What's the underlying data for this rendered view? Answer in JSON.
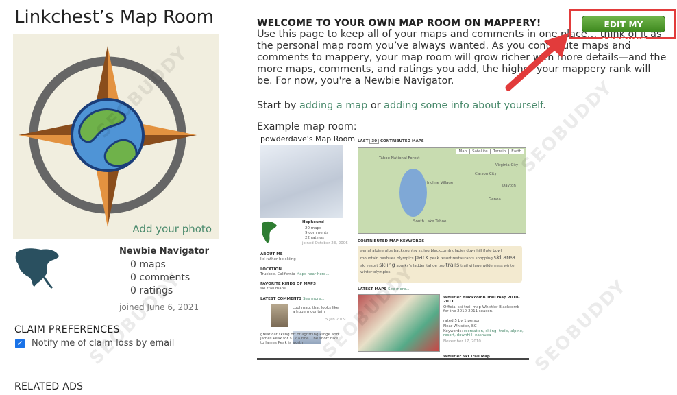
{
  "left": {
    "title": "Linkchest’s Map Room",
    "add_photo": "Add your photo",
    "rank": "Newbie Navigator",
    "stats": [
      {
        "count": "0",
        "label": "maps"
      },
      {
        "count": "0",
        "label": "comments"
      },
      {
        "count": "0",
        "label": "ratings"
      }
    ],
    "joined": "joined June 6, 2021",
    "claim_heading": "CLAIM PREFERENCES",
    "claim_option": "Notify me of claim loss by email",
    "claim_checked": true,
    "related_heading": "RELATED ADS"
  },
  "main": {
    "welcome_heading": "WELCOME TO YOUR OWN MAP ROOM ON MAPPERY!",
    "intro": "Use this page to keep all of your maps and comments in one place… think of it as the personal map room you’ve always wanted. As you contribute maps and comments to mappery, your map room will grow richer with more details—and the more maps, comments, and ratings you add, the higher your mappery rank will be. For now, you're a Newbie Navigator.",
    "start_prefix": "Start by",
    "link_add_map": "adding a map",
    "start_or": "or",
    "link_add_info": "adding some info about yourself",
    "start_suffix": ".",
    "example_label": "Example map room:",
    "edit_account": "EDIT MY ACCOUNT"
  },
  "example": {
    "title": "powderdave's Map Room",
    "username": "Hophound",
    "stats": [
      "20 maps",
      "9 comments",
      "22 ratings"
    ],
    "joined": "joined October 23, 2006",
    "about_heading": "ABOUT ME",
    "about_text": "I'd rather be skiing",
    "location_heading": "LOCATION",
    "location_text": "Truckee, California",
    "location_link": "Maps near here...",
    "favorite_heading": "FAVORITE KINDS OF MAPS",
    "favorite_text": "ski trail maps",
    "latest_comments_heading": "LATEST COMMENTS",
    "see_more": "See more...",
    "comment1": "cool map, that looks like a huge mountain",
    "comment1_date": "5 Jan 2009",
    "comment2": "great cat skiing off of lightning Ridge and James Peak for $12 a ride. The short hike to James Peak is worth",
    "last_label": "LAST",
    "last_value": "30",
    "contributed_maps": "CONTRIBUTED MAPS",
    "map_tabs": [
      "Map",
      "Satellite",
      "Terrain",
      "Earth"
    ],
    "map_labels": [
      "Tahoe National Forest",
      "Carson City",
      "Incline Village",
      "South Lake Tahoe",
      "Genoa",
      "Virginia City",
      "Dayton"
    ],
    "keywords_heading": "CONTRIBUTED MAP KEYWORDS",
    "keywords": [
      "aerial",
      "alpine",
      "alps",
      "backcountry skiing",
      "blackcomb glacier",
      "downhill",
      "flute bowl",
      "mountain",
      "nashuea",
      "olympics",
      "park",
      "peak",
      "resort",
      "restaurants",
      "shopping",
      "ski area",
      "ski",
      "resort",
      "skiing",
      "sparky's ladder",
      "tahoe",
      "top",
      "trails",
      "trail",
      "village",
      "wilderness",
      "winter",
      "winter olympics"
    ],
    "latest_maps_heading": "LATEST MAPS",
    "latest_map_title": "Whistler Blackcomb Trail map 2010-2011",
    "latest_map_desc": "Official ski trail map Whistler Blackcomb for the 2010-2011 season.",
    "latest_map_rating": "rated 5 by 1 person",
    "latest_map_location": "Near Whistler, BC",
    "latest_map_keywords_label": "Keywords:",
    "latest_map_keywords": "recreation, skiing, trails, alpine, resort, downhill, nashuea",
    "latest_map_date": "November 17, 2010",
    "next_map_title": "Whistler Ski Trail Map"
  },
  "watermark": "SEOBUDDY",
  "colors": {
    "link": "#4a8a6c",
    "button": "#4f9a2b",
    "highlight": "#e23b3b",
    "checkbox": "#1a73e8"
  }
}
